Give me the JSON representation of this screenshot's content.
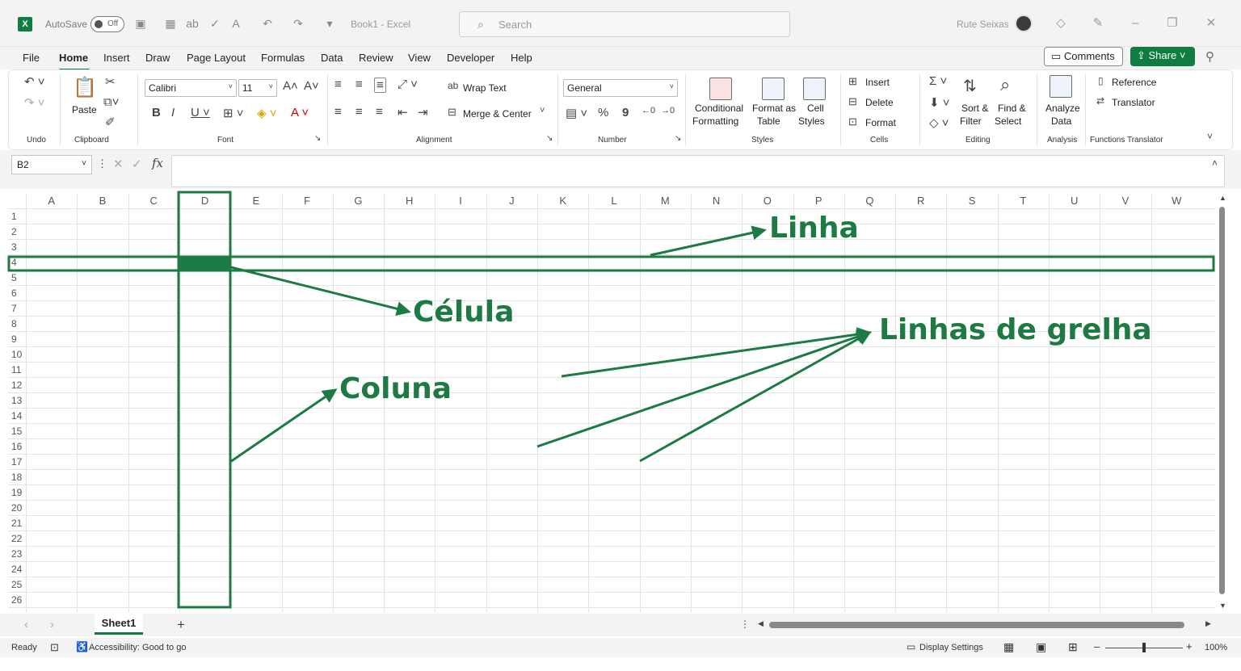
{
  "titlebar": {
    "autosave_label": "AutoSave",
    "autosave_state": "Off",
    "doc_title": "Book1  -  Excel",
    "search_placeholder": "Search",
    "user_name": "Rute Seixas"
  },
  "menu": {
    "items": [
      "File",
      "Home",
      "Insert",
      "Draw",
      "Page Layout",
      "Formulas",
      "Data",
      "Review",
      "View",
      "Developer",
      "Help"
    ],
    "active": "Home",
    "comments_label": "Comments",
    "share_label": "Share"
  },
  "ribbon": {
    "groups": [
      "Undo",
      "Clipboard",
      "Font",
      "Alignment",
      "Number",
      "Styles",
      "Cells",
      "Editing",
      "Analysis",
      "Functions Translator"
    ],
    "paste_label": "Paste",
    "font_name": "Calibri",
    "font_size": "11",
    "wrap_text": "Wrap Text",
    "merge_center": "Merge & Center",
    "number_format": "General",
    "conditional_formatting": [
      "Conditional",
      "Formatting"
    ],
    "format_as_table": [
      "Format as",
      "Table"
    ],
    "cell_styles": [
      "Cell",
      "Styles"
    ],
    "insert": "Insert",
    "delete": "Delete",
    "format": "Format",
    "sort_filter": [
      "Sort &",
      "Filter"
    ],
    "find_select": [
      "Find &",
      "Select"
    ],
    "analyze_data": [
      "Analyze",
      "Data"
    ],
    "reference": "Reference",
    "translator": "Translator"
  },
  "formula_bar": {
    "name_box": "B2",
    "fx": "fx",
    "value": ""
  },
  "grid": {
    "columns": [
      "A",
      "B",
      "C",
      "D",
      "E",
      "F",
      "G",
      "H",
      "I",
      "J",
      "K",
      "L",
      "M",
      "N",
      "O",
      "P",
      "Q",
      "R",
      "S",
      "T",
      "U",
      "V",
      "W"
    ],
    "rows": [
      "1",
      "2",
      "3",
      "4",
      "5",
      "6",
      "7",
      "8",
      "9",
      "10",
      "11",
      "12",
      "13",
      "14",
      "15",
      "16",
      "17",
      "18",
      "19",
      "20",
      "21",
      "22",
      "23",
      "24",
      "25",
      "26"
    ],
    "highlight_column": "D",
    "highlight_row": "4",
    "highlight_color": "#1d7a43"
  },
  "annotations": {
    "linha": "Linha",
    "celula": "Célula",
    "coluna": "Coluna",
    "grelha": "Linhas de grelha"
  },
  "tabs": {
    "sheet": "Sheet1",
    "add": "+"
  },
  "status": {
    "ready": "Ready",
    "accessibility": "Accessibility: Good to go",
    "display_settings": "Display Settings",
    "zoom": "100%"
  },
  "colors": {
    "accent": "#107c41",
    "annotation": "#1d7a43"
  }
}
